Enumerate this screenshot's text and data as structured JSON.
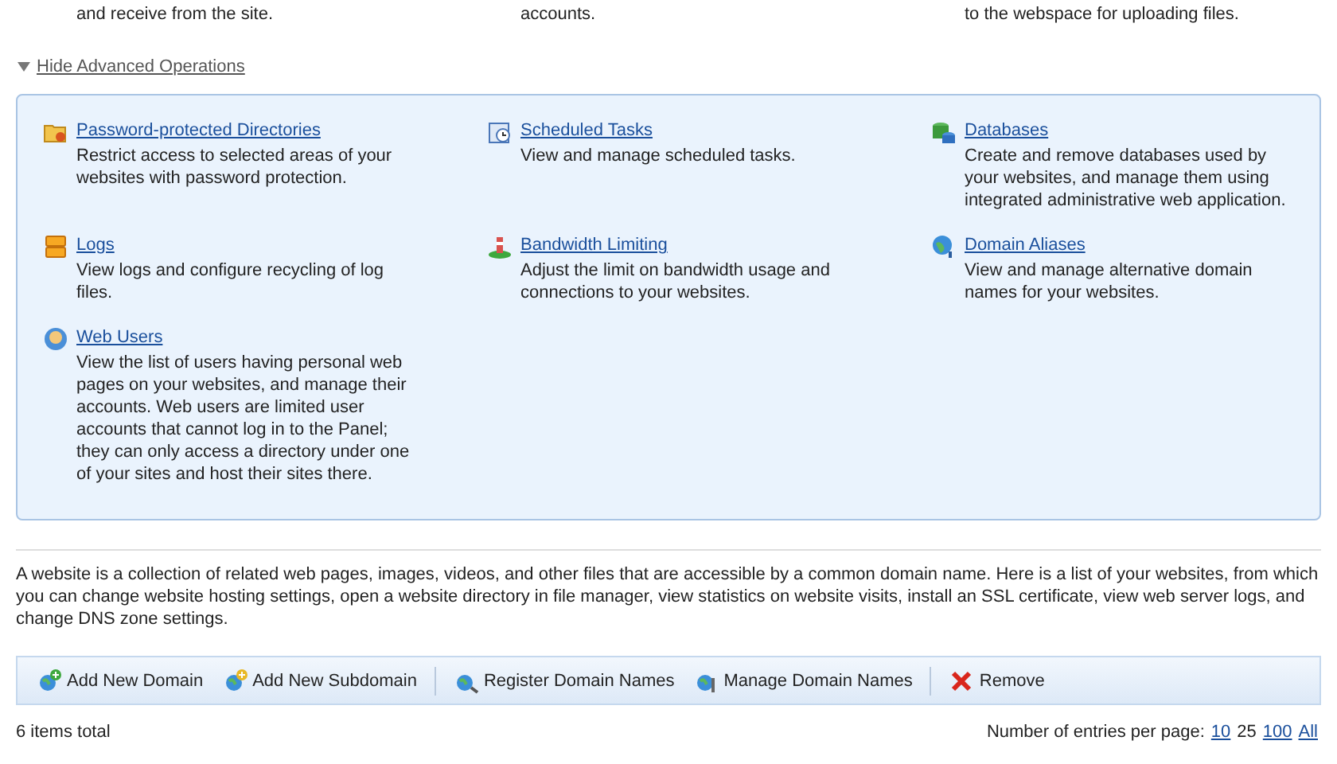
{
  "top_descriptions": [
    "and receive from the site.",
    "accounts.",
    "to the webspace for uploading files."
  ],
  "advanced_toggle": {
    "label": "Hide Advanced Operations",
    "expanded": true
  },
  "operations": [
    {
      "kind": "folder-lock",
      "title": "Password-protected Directories",
      "description": "Restrict access to selected areas of your websites with password protection."
    },
    {
      "kind": "clock",
      "title": "Scheduled Tasks",
      "description": "View and manage scheduled tasks."
    },
    {
      "kind": "database",
      "title": "Databases",
      "description": "Create and remove databases used by your websites, and manage them using integrated administrative web application."
    },
    {
      "kind": "log",
      "title": "Logs",
      "description": "View logs and configure recycling of log files."
    },
    {
      "kind": "gauge",
      "title": "Bandwidth Limiting",
      "description": "Adjust the limit on bandwidth usage and connections to your websites."
    },
    {
      "kind": "globe",
      "title": "Domain Aliases",
      "description": "View and manage alternative domain names for your websites."
    },
    {
      "kind": "user",
      "title": "Web Users",
      "description": "View the list of users having personal web pages on your websites, and manage their accounts. Web users are limited user accounts that cannot log in to the Panel; they can only access a directory under one of your sites and host their sites there."
    }
  ],
  "intro": "A website is a collection of related web pages, images, videos, and other files that are accessible by a common domain name. Here is a list of your websites, from which you can change website hosting settings, open a website directory in file manager, view statistics on website visits, install an SSL certificate, view web server logs, and change DNS zone settings.",
  "toolbar": [
    {
      "kind": "add",
      "label": "Add New Domain"
    },
    {
      "kind": "add-sub",
      "label": "Add New Subdomain"
    },
    {
      "kind": "separator"
    },
    {
      "kind": "register",
      "label": "Register Domain Names"
    },
    {
      "kind": "manage",
      "label": "Manage Domain Names"
    },
    {
      "kind": "separator"
    },
    {
      "kind": "remove",
      "label": "Remove"
    }
  ],
  "items_total": "6 items total",
  "pagination": {
    "label": "Number of entries per page:",
    "options": [
      {
        "label": "10",
        "selected": false
      },
      {
        "label": "25",
        "selected": true
      },
      {
        "label": "100",
        "selected": false
      },
      {
        "label": "All",
        "selected": false
      }
    ]
  }
}
